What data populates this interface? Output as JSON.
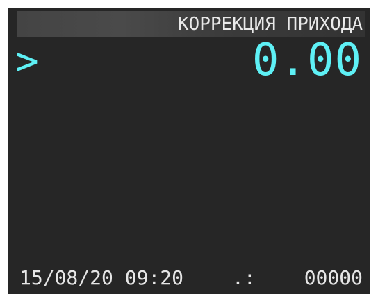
{
  "header": {
    "title": "КОРРЕКЦИЯ ПРИХОДА"
  },
  "main": {
    "prompt": ">",
    "amount": "0.00"
  },
  "status_bar": {
    "datetime": "15/08/20 09:20",
    "separator": ".:",
    "counter": "00000"
  },
  "colors": {
    "background": "#262626",
    "accent": "#5ef0f5",
    "text": "#e6e6e6",
    "header_bar": "#444444"
  }
}
